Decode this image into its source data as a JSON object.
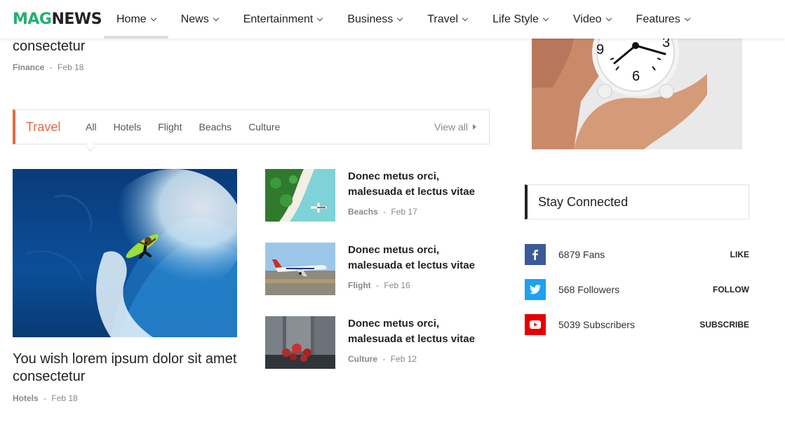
{
  "header": {
    "logo_part1": "MAG",
    "logo_part2": "NEWS",
    "nav": [
      {
        "label": "Home"
      },
      {
        "label": "News"
      },
      {
        "label": "Entertainment"
      },
      {
        "label": "Business"
      },
      {
        "label": "Travel"
      },
      {
        "label": "Life Style"
      },
      {
        "label": "Video"
      },
      {
        "label": "Features"
      }
    ]
  },
  "top_article": {
    "title": "consectetur",
    "category": "Finance",
    "separator": "-",
    "date": "Feb 18"
  },
  "travel_section": {
    "title": "Travel",
    "tabs": [
      "All",
      "Hotels",
      "Flight",
      "Beachs",
      "Culture"
    ],
    "view_all": "View all",
    "featured": {
      "title": "You wish lorem ipsum dolor sit amet consectetur",
      "category": "Hotels",
      "separator": "-",
      "date": "Feb 18"
    },
    "list": [
      {
        "title": "Donec metus orci, malesuada et lectus vitae",
        "category": "Beachs",
        "separator": "-",
        "date": "Feb 17"
      },
      {
        "title": "Donec metus orci, malesuada et lectus vitae",
        "category": "Flight",
        "separator": "-",
        "date": "Feb 16"
      },
      {
        "title": "Donec metus orci, malesuada et lectus vitae",
        "category": "Culture",
        "separator": "-",
        "date": "Feb 12"
      }
    ]
  },
  "sidebar": {
    "stay_connected_title": "Stay Connected",
    "social": [
      {
        "icon": "facebook-icon",
        "count": "6879 Fans",
        "action": "LIKE",
        "color": "#3b5998"
      },
      {
        "icon": "twitter-icon",
        "count": "568 Followers",
        "action": "FOLLOW",
        "color": "#1da1f2"
      },
      {
        "icon": "youtube-icon",
        "count": "5039 Subscribers",
        "action": "SUBSCRIBE",
        "color": "#e60000"
      }
    ]
  },
  "colors": {
    "brand_green": "#1fb16f",
    "travel_accent": "#e6693e"
  }
}
